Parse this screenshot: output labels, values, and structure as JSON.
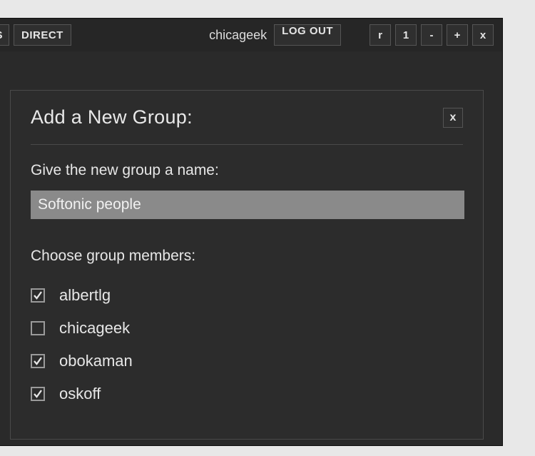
{
  "topbar": {
    "tab_es": "ES",
    "tab_direct": "DIRECT",
    "username": "chicageek",
    "logout": "LOG OUT",
    "controls": {
      "r": "r",
      "one": "1",
      "minus": "-",
      "plus": "+",
      "close": "x"
    }
  },
  "dialog": {
    "title": "Add a New Group:",
    "close": "x",
    "name_label": "Give the new group a name:",
    "name_value": "Softonic people",
    "members_label": "Choose group members:",
    "members": [
      {
        "name": "albertlg",
        "checked": true
      },
      {
        "name": "chicageek",
        "checked": false
      },
      {
        "name": "obokaman",
        "checked": true
      },
      {
        "name": "oskoff",
        "checked": true
      }
    ]
  }
}
